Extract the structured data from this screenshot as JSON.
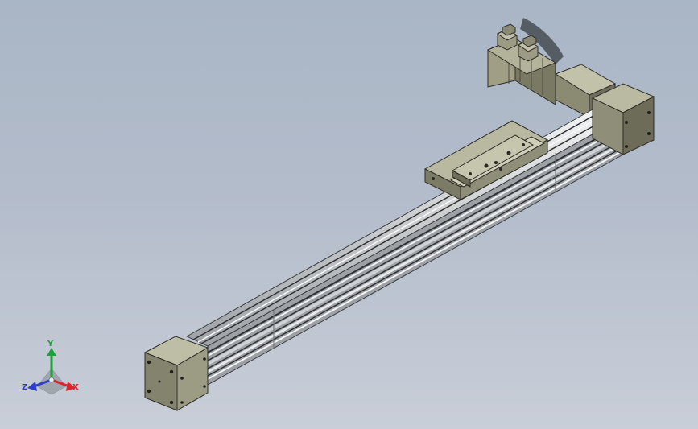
{
  "triad": {
    "x_label": "X",
    "y_label": "Y",
    "z_label": "Z",
    "x_color": "#d8242a",
    "y_color": "#1fa03a",
    "z_color": "#2d3fc4"
  },
  "colors": {
    "background_top": "#a9b6c6",
    "background_bottom": "#c9ced8",
    "endcap_face": "#86856f",
    "profile_highlight": "#eef0f1",
    "motor_body": "#8e8d76"
  }
}
